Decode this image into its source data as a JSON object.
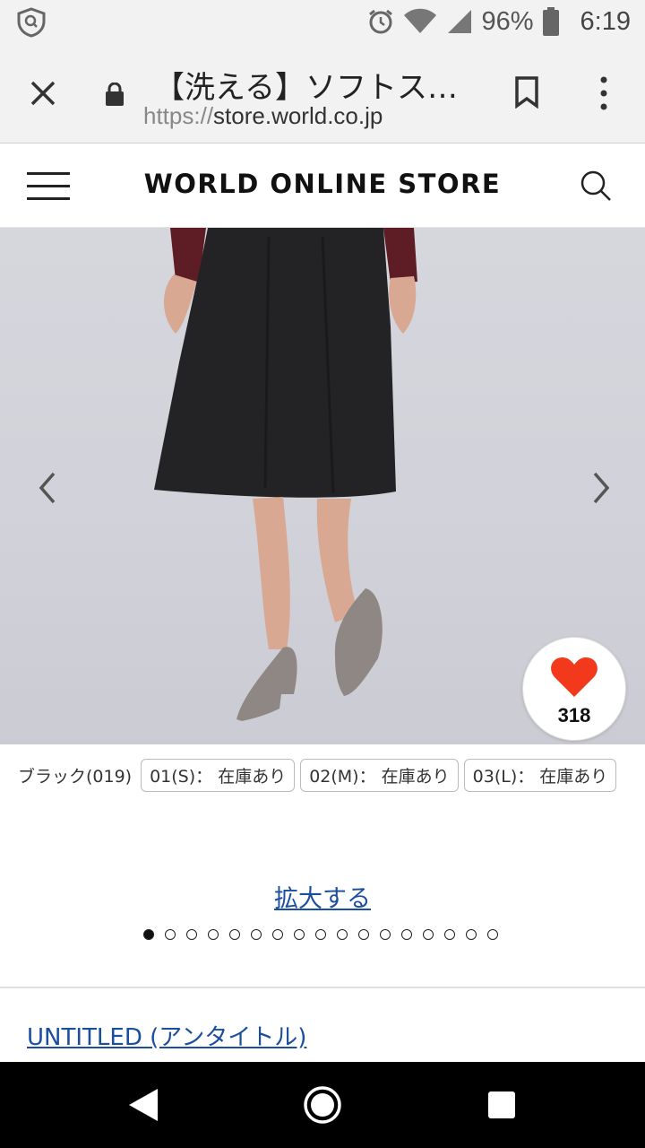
{
  "status_bar": {
    "battery_percent": "96%",
    "time": "6:19"
  },
  "browser": {
    "tab_title": "【洗える】ソフトス…",
    "url_scheme": "https://",
    "url_host": "store.world.co.jp"
  },
  "site": {
    "logo": "WORLD ONLINE STORE"
  },
  "product": {
    "favorite_count": "318",
    "color_label": "ブラック(019)",
    "stock": [
      {
        "label": "01(S)： 在庫あり"
      },
      {
        "label": "02(M)： 在庫あり"
      },
      {
        "label": "03(L)： 在庫あり"
      }
    ],
    "zoom_label": "拡大する",
    "image_count": 17,
    "active_image": 1,
    "brand_link": "UNTITLED (アンタイトル)"
  },
  "colors": {
    "link": "#1a4fa0",
    "heart": "#f2391b",
    "skirt": "#232325",
    "sleeve": "#5e1c24"
  }
}
